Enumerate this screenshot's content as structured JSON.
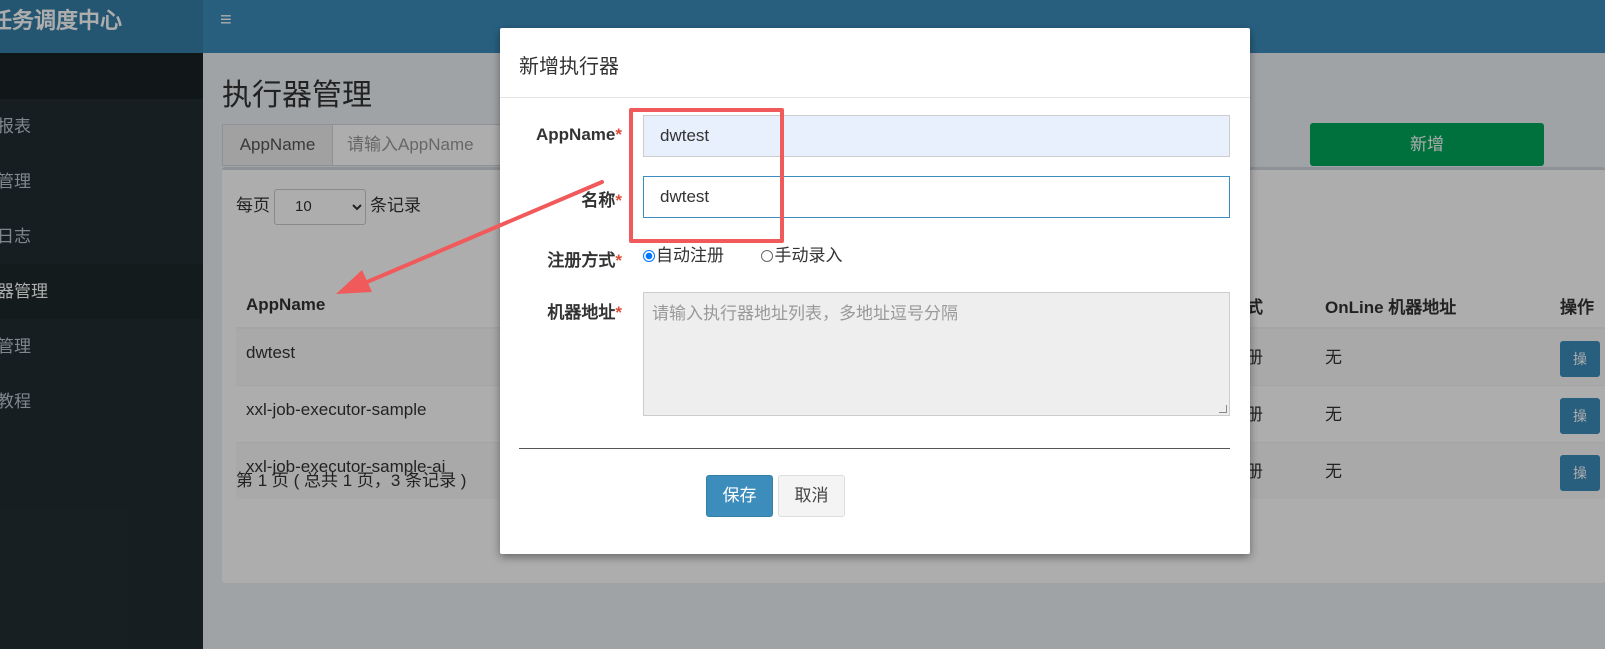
{
  "header": {
    "brand": "任务调度中心",
    "menu_icon": "≡"
  },
  "sidebar": {
    "items": [
      {
        "label": "报表",
        "active": false
      },
      {
        "label": "管理",
        "active": false
      },
      {
        "label": "日志",
        "active": false
      },
      {
        "label": "器管理",
        "active": true
      },
      {
        "label": "管理",
        "active": false
      },
      {
        "label": "教程",
        "active": false
      }
    ]
  },
  "page": {
    "title": "执行器管理",
    "filter": {
      "label": "AppName",
      "placeholder": "请输入AppName"
    },
    "add_button": "新增",
    "per_page": {
      "prefix": "每页",
      "value": "10",
      "suffix": "条记录"
    },
    "table": {
      "headers": {
        "appname": "AppName",
        "reg_type": "式",
        "online": "OnLine 机器地址",
        "ops": "操作"
      },
      "rows": [
        {
          "appname": "dwtest",
          "reg": "册",
          "online": "无",
          "op": "操"
        },
        {
          "appname": "xxl-job-executor-sample",
          "reg": "册",
          "online": "无",
          "op": "操"
        },
        {
          "appname": "xxl-job-executor-sample-ai",
          "reg": "册",
          "online": "无",
          "op": "操"
        }
      ]
    },
    "pagination": "第 1 页 ( 总共 1 页，3 条记录 )"
  },
  "modal": {
    "title": "新增执行器",
    "appname": {
      "label": "AppName",
      "required": "*",
      "value": "dwtest"
    },
    "name": {
      "label": "名称",
      "required": "*",
      "value": "dwtest"
    },
    "reg_type": {
      "label": "注册方式",
      "required": "*",
      "options": [
        {
          "label": "自动注册",
          "checked": true
        },
        {
          "label": "手动录入",
          "checked": false
        }
      ]
    },
    "address": {
      "label": "机器地址",
      "required": "*",
      "placeholder": "请输入执行器地址列表，多地址逗号分隔"
    },
    "save": "保存",
    "cancel": "取消"
  },
  "annotation": {
    "color": "#f05a5a"
  }
}
